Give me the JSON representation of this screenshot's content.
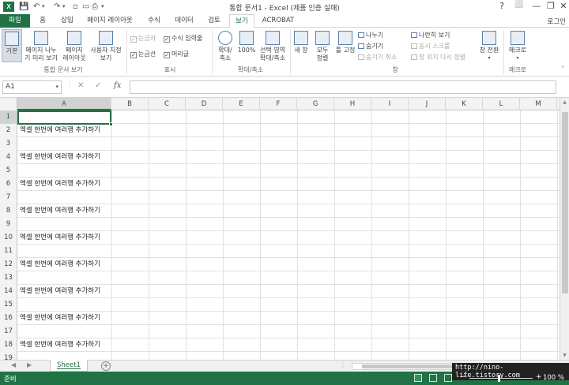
{
  "window": {
    "title": "통합 문서1 - Excel (제품 인증 실패)",
    "app_icon": "X",
    "controls": [
      "?",
      "⬜",
      "—",
      "❐",
      "✕"
    ]
  },
  "ribbon_tabs": [
    {
      "label": "파일"
    },
    {
      "label": "홈"
    },
    {
      "label": "삽입"
    },
    {
      "label": "페이지 레이아웃"
    },
    {
      "label": "수식"
    },
    {
      "label": "데이터"
    },
    {
      "label": "검토"
    },
    {
      "label": "보기"
    },
    {
      "label": "ACROBAT"
    }
  ],
  "active_tab": "보기",
  "login_label": "로그인",
  "ribbon": {
    "workbook_views": {
      "normal": "기본",
      "page_break_1": "페이지 나누",
      "page_break_2": "기 미리 보기",
      "page_layout_1": "페이지",
      "page_layout_2": "레이아웃",
      "custom_1": "사용자 지정",
      "custom_2": "보기",
      "group_label": "통합 문서 보기"
    },
    "show": {
      "ruler": "눈금자",
      "formula_bar": "수식 입력줄",
      "gridlines": "눈금선",
      "headings": "머리글",
      "group_label": "표시"
    },
    "zoom": {
      "zoom_1": "확대/",
      "zoom_2": "축소",
      "hundred": "100%",
      "selection_1": "선택 영역",
      "selection_2": "확대/축소",
      "group_label": "확대/축소"
    },
    "window": {
      "new_window": "새 창",
      "arrange_1": "모두",
      "arrange_2": "정렬",
      "freeze": "틀 고정",
      "split": "나누기",
      "hide": "숨기기",
      "unhide": "숨기기 취소",
      "side_by_side": "나란히 보기",
      "sync_scroll": "동시 스크롤",
      "reset_pos": "창 위치 다시 정렬",
      "switch_1": "창 전환",
      "group_label": "창"
    },
    "macros": {
      "label": "매크로",
      "group_label": "매크로"
    }
  },
  "formula_bar": {
    "name_box": "A1",
    "cancel": "✕",
    "enter": "✓",
    "fx": "fx",
    "value": ""
  },
  "columns": [
    "A",
    "B",
    "C",
    "D",
    "E",
    "F",
    "G",
    "H",
    "I",
    "J",
    "K",
    "L",
    "M"
  ],
  "rows": [
    {
      "num": "1",
      "a": ""
    },
    {
      "num": "2",
      "a": "엑셀 한번에 여러행 추가하기"
    },
    {
      "num": "3",
      "a": ""
    },
    {
      "num": "4",
      "a": "엑셀 한번에 여러행 추가하기"
    },
    {
      "num": "5",
      "a": ""
    },
    {
      "num": "6",
      "a": "엑셀 한번에 여러행 추가하기"
    },
    {
      "num": "7",
      "a": ""
    },
    {
      "num": "8",
      "a": "엑셀 한번에 여러행 추가하기"
    },
    {
      "num": "9",
      "a": ""
    },
    {
      "num": "10",
      "a": "엑셀 한번에 여러행 추가하기"
    },
    {
      "num": "11",
      "a": ""
    },
    {
      "num": "12",
      "a": "엑셀 한번에 여러행 추가하기"
    },
    {
      "num": "13",
      "a": ""
    },
    {
      "num": "14",
      "a": "엑셀 한번에 여러행 추가하기"
    },
    {
      "num": "15",
      "a": ""
    },
    {
      "num": "16",
      "a": "엑셀 한번에 여러행 추가하기"
    },
    {
      "num": "17",
      "a": ""
    },
    {
      "num": "18",
      "a": "엑셀 한번에 여러행 추가하기"
    },
    {
      "num": "19",
      "a": ""
    }
  ],
  "sheet_tabs": [
    {
      "label": "Sheet1"
    }
  ],
  "status": {
    "ready": "준비",
    "zoom": "100 %",
    "watermark": "http://nino-life.tistory.com"
  },
  "colors": {
    "accent": "#217346",
    "selected_header": "#d2d2d2"
  }
}
